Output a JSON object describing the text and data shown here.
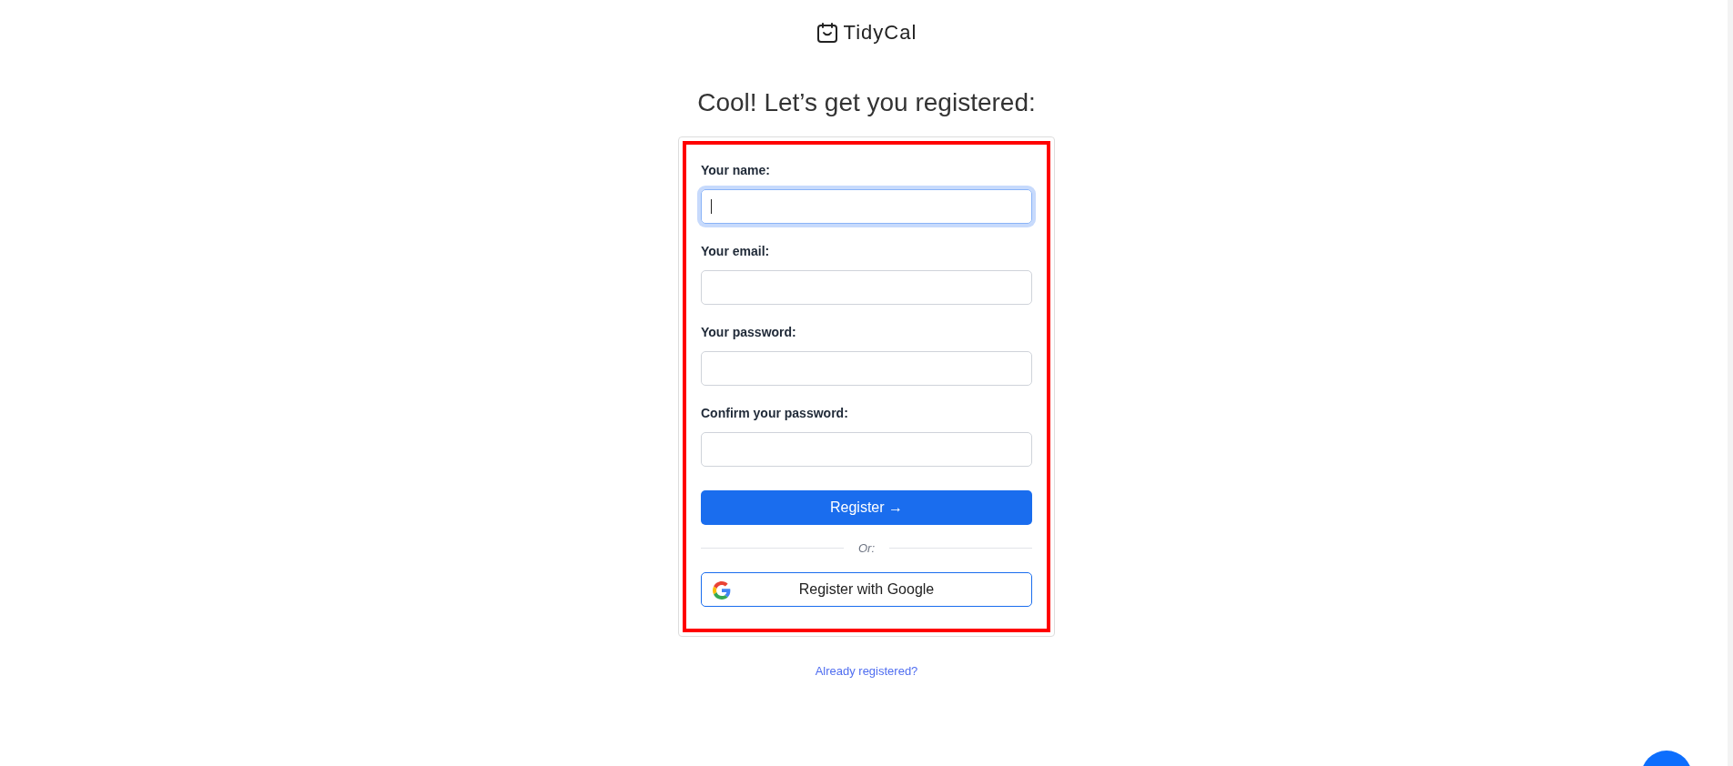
{
  "logo": {
    "text": "TidyCal"
  },
  "heading": "Cool! Let’s get you registered:",
  "form": {
    "fields": [
      {
        "label": "Your name:",
        "focused": true
      },
      {
        "label": "Your email:",
        "focused": false
      },
      {
        "label": "Your password:",
        "focused": false
      },
      {
        "label": "Confirm your password:",
        "focused": false
      }
    ],
    "submit": "Register →",
    "divider": "Or:",
    "google_button": "Register with Google"
  },
  "login_link": "Already registered?"
}
